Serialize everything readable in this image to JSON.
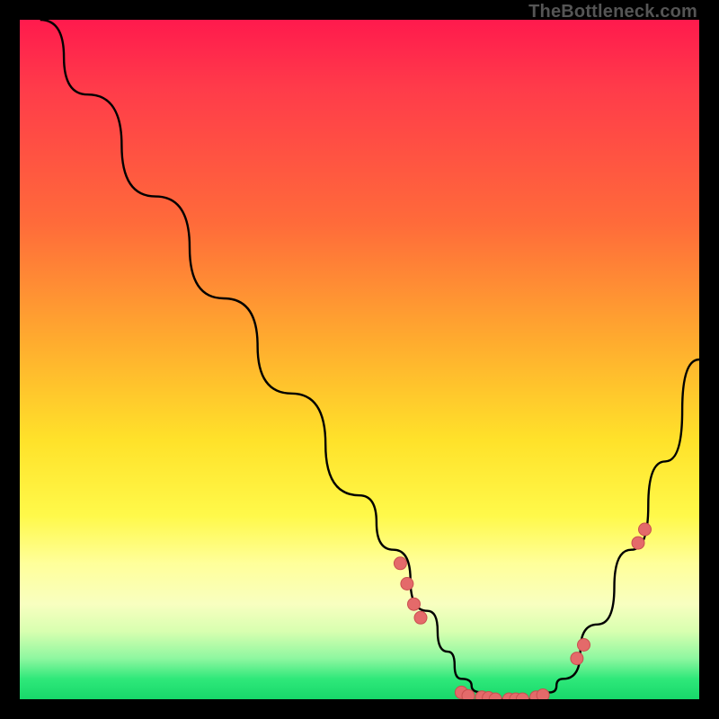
{
  "watermark": "TheBottleneck.com",
  "colors": {
    "background": "#000000",
    "curve": "#000000",
    "dot_fill": "#e46a6a",
    "dot_stroke": "#c94f4f",
    "gradient_top": "#ff1a4d",
    "gradient_bottom": "#17d86a"
  },
  "chart_data": {
    "type": "line",
    "title": "",
    "xlabel": "",
    "ylabel": "",
    "xlim": [
      0,
      100
    ],
    "ylim": [
      0,
      100
    ],
    "grid": false,
    "legend": false,
    "series": [
      {
        "name": "bottleneck-curve",
        "x": [
          3,
          10,
          20,
          30,
          40,
          50,
          55,
          60,
          63,
          65,
          68,
          70,
          73,
          75,
          78,
          80,
          85,
          90,
          95,
          100
        ],
        "y": [
          100,
          89,
          74,
          59,
          45,
          30,
          22,
          13,
          7,
          3,
          1,
          0,
          0,
          0,
          1,
          3,
          11,
          22,
          35,
          50
        ]
      }
    ],
    "markers": [
      {
        "x": 56,
        "y": 20
      },
      {
        "x": 57,
        "y": 17
      },
      {
        "x": 58,
        "y": 14
      },
      {
        "x": 59,
        "y": 12
      },
      {
        "x": 65,
        "y": 1
      },
      {
        "x": 66,
        "y": 0.5
      },
      {
        "x": 68,
        "y": 0.3
      },
      {
        "x": 69,
        "y": 0.2
      },
      {
        "x": 70,
        "y": 0
      },
      {
        "x": 72,
        "y": 0
      },
      {
        "x": 73,
        "y": 0
      },
      {
        "x": 74,
        "y": 0
      },
      {
        "x": 76,
        "y": 0.3
      },
      {
        "x": 77,
        "y": 0.6
      },
      {
        "x": 82,
        "y": 6
      },
      {
        "x": 83,
        "y": 8
      },
      {
        "x": 91,
        "y": 23
      },
      {
        "x": 92,
        "y": 25
      }
    ]
  }
}
